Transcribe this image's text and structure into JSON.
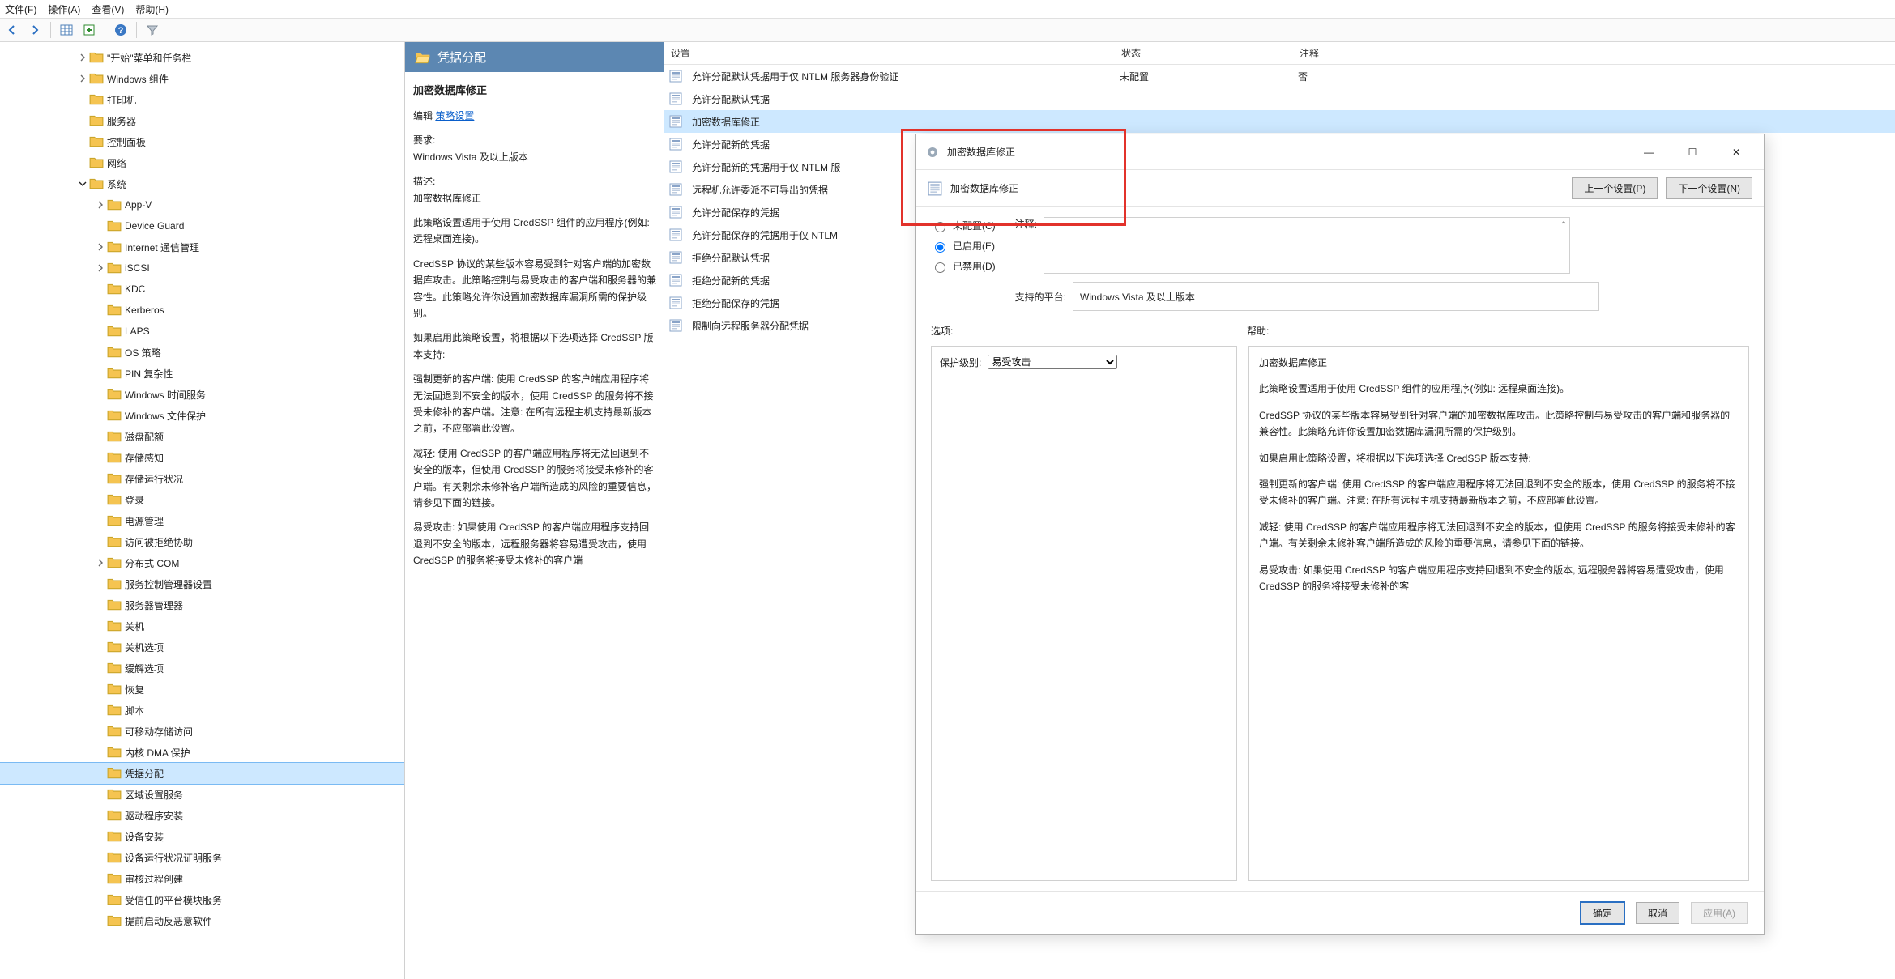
{
  "menubar": [
    "文件(F)",
    "操作(A)",
    "查看(V)",
    "帮助(H)"
  ],
  "toolbar_icons": [
    "back-arrow-icon",
    "forward-arrow-icon",
    "sep",
    "table-icon",
    "export-icon",
    "sep",
    "help-icon",
    "sep",
    "filter-icon"
  ],
  "tree": [
    {
      "depth": 3,
      "expand": "right",
      "label": "\"开始\"菜单和任务栏"
    },
    {
      "depth": 3,
      "expand": "right",
      "label": "Windows 组件"
    },
    {
      "depth": 3,
      "expand": "none",
      "label": "打印机"
    },
    {
      "depth": 3,
      "expand": "none",
      "label": "服务器"
    },
    {
      "depth": 3,
      "expand": "none",
      "label": "控制面板"
    },
    {
      "depth": 3,
      "expand": "none",
      "label": "网络"
    },
    {
      "depth": 3,
      "expand": "down",
      "label": "系统"
    },
    {
      "depth": 4,
      "expand": "right",
      "label": "App-V"
    },
    {
      "depth": 4,
      "expand": "none",
      "label": "Device Guard"
    },
    {
      "depth": 4,
      "expand": "right",
      "label": "Internet 通信管理"
    },
    {
      "depth": 4,
      "expand": "right",
      "label": "iSCSI"
    },
    {
      "depth": 4,
      "expand": "none",
      "label": "KDC"
    },
    {
      "depth": 4,
      "expand": "none",
      "label": "Kerberos"
    },
    {
      "depth": 4,
      "expand": "none",
      "label": "LAPS"
    },
    {
      "depth": 4,
      "expand": "none",
      "label": "OS 策略"
    },
    {
      "depth": 4,
      "expand": "none",
      "label": "PIN 复杂性"
    },
    {
      "depth": 4,
      "expand": "none",
      "label": "Windows 时间服务"
    },
    {
      "depth": 4,
      "expand": "none",
      "label": "Windows 文件保护"
    },
    {
      "depth": 4,
      "expand": "none",
      "label": "磁盘配额"
    },
    {
      "depth": 4,
      "expand": "none",
      "label": "存储感知"
    },
    {
      "depth": 4,
      "expand": "none",
      "label": "存储运行状况"
    },
    {
      "depth": 4,
      "expand": "none",
      "label": "登录"
    },
    {
      "depth": 4,
      "expand": "none",
      "label": "电源管理"
    },
    {
      "depth": 4,
      "expand": "none",
      "label": "访问被拒绝协助"
    },
    {
      "depth": 4,
      "expand": "right",
      "label": "分布式 COM"
    },
    {
      "depth": 4,
      "expand": "none",
      "label": "服务控制管理器设置"
    },
    {
      "depth": 4,
      "expand": "none",
      "label": "服务器管理器"
    },
    {
      "depth": 4,
      "expand": "none",
      "label": "关机"
    },
    {
      "depth": 4,
      "expand": "none",
      "label": "关机选项"
    },
    {
      "depth": 4,
      "expand": "none",
      "label": "缓解选项"
    },
    {
      "depth": 4,
      "expand": "none",
      "label": "恢复"
    },
    {
      "depth": 4,
      "expand": "none",
      "label": "脚本"
    },
    {
      "depth": 4,
      "expand": "none",
      "label": "可移动存储访问"
    },
    {
      "depth": 4,
      "expand": "none",
      "label": "内核 DMA 保护"
    },
    {
      "depth": 4,
      "expand": "none",
      "label": "凭据分配",
      "selected": true
    },
    {
      "depth": 4,
      "expand": "none",
      "label": "区域设置服务"
    },
    {
      "depth": 4,
      "expand": "none",
      "label": "驱动程序安装"
    },
    {
      "depth": 4,
      "expand": "none",
      "label": "设备安装"
    },
    {
      "depth": 4,
      "expand": "none",
      "label": "设备运行状况证明服务"
    },
    {
      "depth": 4,
      "expand": "none",
      "label": "审核过程创建"
    },
    {
      "depth": 4,
      "expand": "none",
      "label": "受信任的平台模块服务"
    },
    {
      "depth": 4,
      "expand": "none",
      "label": "提前启动反恶意软件"
    }
  ],
  "detail": {
    "header": "凭据分配",
    "title": "加密数据库修正",
    "edit_link": "策略设置",
    "edit_prefix": "编辑",
    "req_label": "要求:",
    "req_value": "Windows Vista 及以上版本",
    "desc_label": "描述:",
    "desc_title": "加密数据库修正",
    "desc_p1": "此策略设置适用于使用 CredSSP 组件的应用程序(例如: 远程桌面连接)。",
    "desc_p2": "CredSSP 协议的某些版本容易受到针对客户端的加密数据库攻击。此策略控制与易受攻击的客户端和服务器的兼容性。此策略允许你设置加密数据库漏洞所需的保护级别。",
    "desc_p3": "如果启用此策略设置，将根据以下选项选择 CredSSP 版本支持:",
    "desc_p4": "强制更新的客户端: 使用 CredSSP 的客户端应用程序将无法回退到不安全的版本，使用 CredSSP 的服务将不接受未修补的客户端。注意: 在所有远程主机支持最新版本之前，不应部署此设置。",
    "desc_p5": "减轻: 使用 CredSSP 的客户端应用程序将无法回退到不安全的版本，但使用 CredSSP 的服务将接受未修补的客户端。有关剩余未修补客户端所造成的风险的重要信息，请参见下面的链接。",
    "desc_p6": "易受攻击: 如果使用 CredSSP 的客户端应用程序支持回退到不安全的版本，远程服务器将容易遭受攻击，使用 CredSSP 的服务将接受未修补的客户端"
  },
  "list": {
    "headers": {
      "setting": "设置",
      "state": "状态",
      "comment": "注释"
    },
    "rows": [
      {
        "label": "允许分配默认凭据用于仅 NTLM 服务器身份验证",
        "state": "未配置",
        "comment": "否"
      },
      {
        "label": "允许分配默认凭据"
      },
      {
        "label": "加密数据库修正",
        "selected": true
      },
      {
        "label": "允许分配新的凭据"
      },
      {
        "label": "允许分配新的凭据用于仅 NTLM 服"
      },
      {
        "label": "远程机允许委派不可导出的凭据"
      },
      {
        "label": "允许分配保存的凭据"
      },
      {
        "label": "允许分配保存的凭据用于仅 NTLM "
      },
      {
        "label": "拒绝分配默认凭据"
      },
      {
        "label": "拒绝分配新的凭据"
      },
      {
        "label": "拒绝分配保存的凭据"
      },
      {
        "label": "限制向远程服务器分配凭据"
      }
    ]
  },
  "dialog": {
    "title": "加密数据库修正",
    "crumb": "加密数据库修正",
    "prev_btn": "上一个设置(P)",
    "next_btn": "下一个设置(N)",
    "radio_unconfigured": "未配置(C)",
    "radio_enabled": "已启用(E)",
    "radio_disabled": "已禁用(D)",
    "comment_label": "注释:",
    "platform_label": "支持的平台:",
    "platform_value": "Windows Vista 及以上版本",
    "options_label": "选项:",
    "help_label": "帮助:",
    "opt_protect_label": "保护级别:",
    "opt_protect_value": "易受攻击",
    "help_title": "加密数据库修正",
    "help_p1": "此策略设置适用于使用 CredSSP 组件的应用程序(例如: 远程桌面连接)。",
    "help_p2": "CredSSP 协议的某些版本容易受到针对客户端的加密数据库攻击。此策略控制与易受攻击的客户端和服务器的兼容性。此策略允许你设置加密数据库漏洞所需的保护级别。",
    "help_p3": "如果启用此策略设置，将根据以下选项选择 CredSSP 版本支持:",
    "help_p4": "强制更新的客户端: 使用 CredSSP 的客户端应用程序将无法回退到不安全的版本，使用 CredSSP 的服务将不接受未修补的客户端。注意: 在所有远程主机支持最新版本之前，不应部署此设置。",
    "help_p5": "减轻: 使用 CredSSP 的客户端应用程序将无法回退到不安全的版本，但使用 CredSSP 的服务将接受未修补的客户端。有关剩余未修补客户端所造成的风险的重要信息，请参见下面的链接。",
    "help_p6": "易受攻击: 如果使用 CredSSP 的客户端应用程序支持回退到不安全的版本, 远程服务器将容易遭受攻击，使用 CredSSP 的服务将接受未修补的客",
    "ok_btn": "确定",
    "cancel_btn": "取消",
    "apply_btn": "应用(A)"
  }
}
